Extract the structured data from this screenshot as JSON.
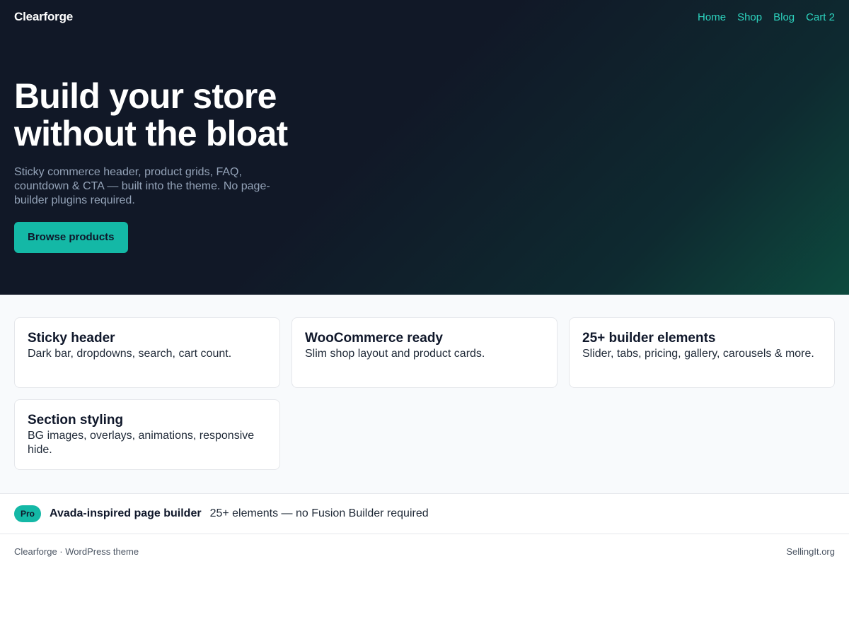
{
  "header": {
    "brand": "Clearforge",
    "nav": [
      {
        "label": "Home"
      },
      {
        "label": "Shop"
      },
      {
        "label": "Blog"
      },
      {
        "label": "Cart 2"
      }
    ]
  },
  "hero": {
    "title_line1": "Build your store",
    "title_line2": "without the bloat",
    "subtitle": "Sticky commerce header, product grids, FAQ, countdown & CTA — built into the theme. No page-builder plugins required.",
    "cta_label": "Browse products"
  },
  "features": [
    {
      "title": "Sticky header",
      "desc": "Dark bar, dropdowns, search, cart count."
    },
    {
      "title": "WooCommerce ready",
      "desc": "Slim shop layout and product cards."
    },
    {
      "title": "25+ builder elements",
      "desc": "Slider, tabs, pricing, gallery, carousels & more."
    },
    {
      "title": "Section styling",
      "desc": "BG images, overlays, animations, responsive hide."
    }
  ],
  "pro": {
    "badge": "Pro",
    "title": "Avada-inspired page builder",
    "desc": "25+ elements — no Fusion Builder required"
  },
  "footer": {
    "left": "Clearforge · WordPress theme",
    "right": "SellingIt.org"
  },
  "colors": {
    "accent": "#14b8a6",
    "nav_link": "#2dd4bf",
    "hero_bg": "#111827"
  }
}
